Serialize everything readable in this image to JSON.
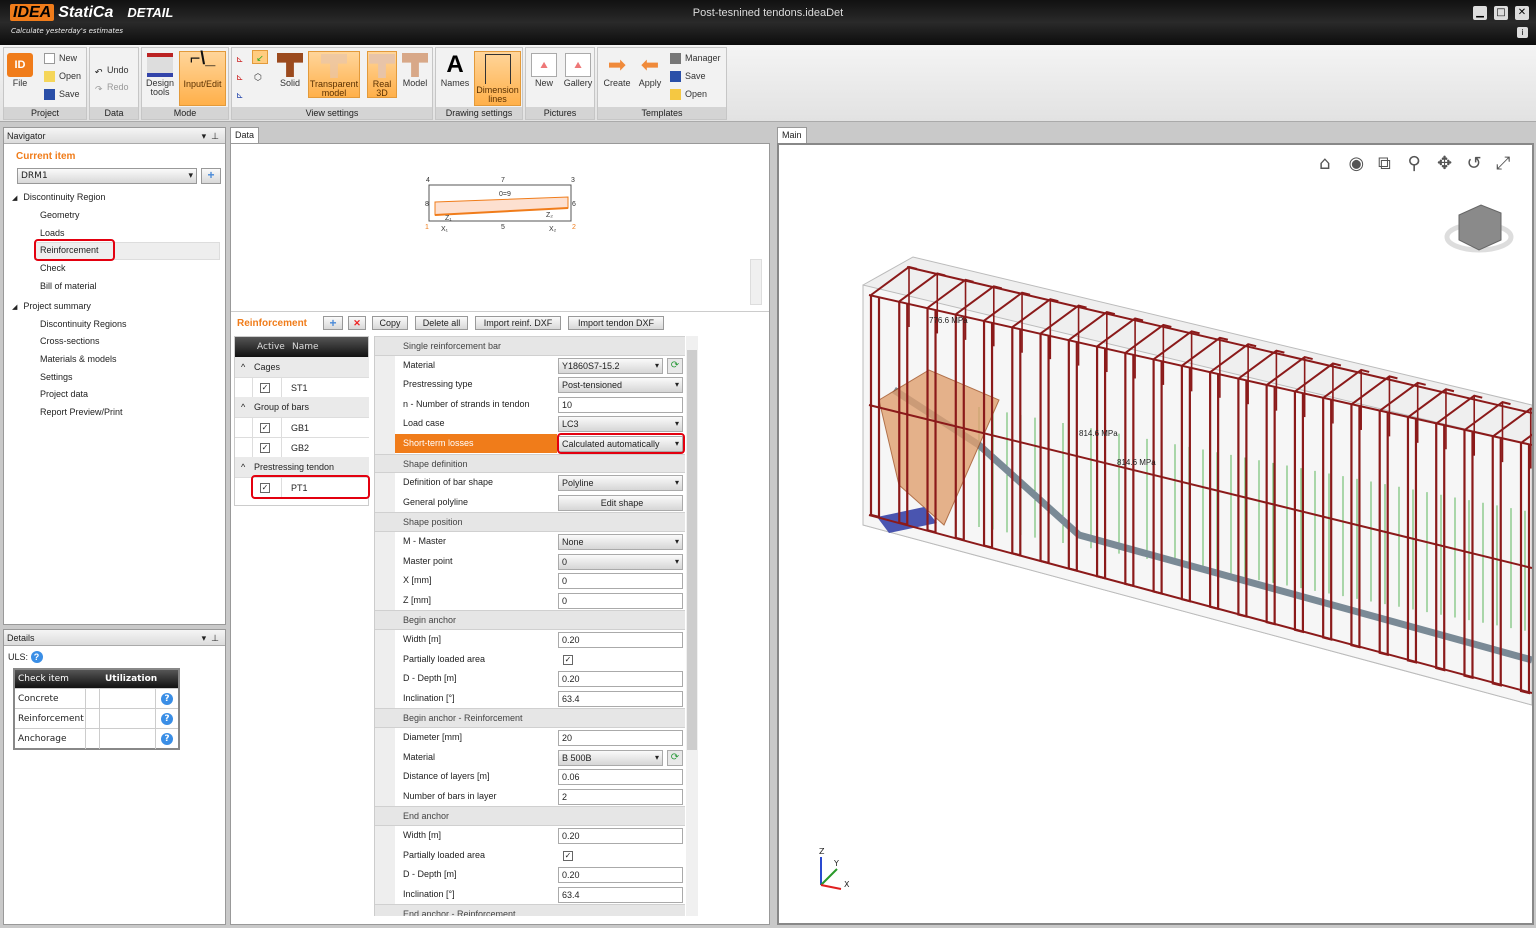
{
  "app": {
    "brand_logo": "IDEA",
    "brand": "StatiCa",
    "edition": "DETAIL",
    "tagline": "Calculate yesterday's estimates",
    "document_title": "Post-tesnined tendons.ideaDet"
  },
  "window": {
    "minimize": "▁",
    "maximize": "□",
    "close": "✕",
    "info": "i"
  },
  "ribbon": {
    "groups": {
      "project": "Project",
      "data": "Data",
      "mode": "Mode",
      "view": "View settings",
      "drawing": "Drawing settings",
      "pictures": "Pictures",
      "templates": "Templates"
    },
    "file": "File",
    "new": "New",
    "open": "Open",
    "save": "Save",
    "undo": "Undo",
    "redo": "Redo",
    "design_tools": "Design tools",
    "input_edit": "Input/Edit",
    "solid": "Solid",
    "transparent": "Transparent model",
    "real3d": "Real 3D",
    "model": "Model",
    "names": "Names",
    "dimension_lines": "Dimension lines",
    "pic_new": "New",
    "gallery": "Gallery",
    "create": "Create",
    "apply": "Apply",
    "manager": "Manager",
    "tpl_save": "Save",
    "tpl_open": "Open"
  },
  "navigator": {
    "title": "Navigator",
    "current_item_label": "Current item",
    "current_item": "DRM1",
    "sections": [
      {
        "label": "Discontinuity Region",
        "items": [
          "Geometry",
          "Loads",
          "Reinforcement",
          "Check",
          "Bill of material"
        ]
      },
      {
        "label": "Project summary",
        "items": [
          "Discontinuity Regions",
          "Cross-sections",
          "Materials & models",
          "Settings",
          "Project data",
          "Report Preview/Print"
        ]
      }
    ],
    "selected": "Reinforcement"
  },
  "details": {
    "title": "Details",
    "uls_label": "ULS:",
    "columns": [
      "Check item",
      "",
      "Utilization",
      ""
    ],
    "rows": [
      "Concrete",
      "Reinforcement",
      "Anchorage"
    ]
  },
  "data_panel": {
    "tab": "Data",
    "sketch_labels": {
      "n4": "4",
      "n7": "7",
      "n3": "3",
      "n8": "8",
      "n6": "6",
      "n09": "0=9",
      "n1": "1",
      "n5": "5",
      "n2": "2",
      "x1": "X₁",
      "x2": "X₂",
      "z1": "Z₁",
      "z2": "Z₂"
    },
    "reinforcement_title": "Reinforcement",
    "toolbar": {
      "copy": "Copy",
      "delete_all": "Delete all",
      "import_reinf": "Import reinf. DXF",
      "import_tendon": "Import tendon DXF"
    },
    "list_columns": [
      "Active",
      "Name"
    ],
    "list_groups": [
      {
        "label": "Cages",
        "items": [
          {
            "name": "ST1",
            "active": true
          }
        ]
      },
      {
        "label": "Group of bars",
        "items": [
          {
            "name": "GB1",
            "active": true
          },
          {
            "name": "GB2",
            "active": true
          }
        ]
      },
      {
        "label": "Prestressing tendon",
        "items": [
          {
            "name": "PT1",
            "active": true
          }
        ]
      }
    ],
    "properties": [
      {
        "type": "cat",
        "label": "Single reinforcement bar"
      },
      {
        "label": "Material",
        "value": "Y1860S7-15.2",
        "kind": "dd-refresh"
      },
      {
        "label": "Prestressing type",
        "value": "Post-tensioned",
        "kind": "dd"
      },
      {
        "label": "n - Number of strands in tendon",
        "value": "10",
        "kind": "text"
      },
      {
        "label": "Load case",
        "value": "LC3",
        "kind": "dd"
      },
      {
        "label": "Short-term losses",
        "value": "Calculated automatically",
        "kind": "dd",
        "selected": true
      },
      {
        "type": "cat",
        "label": "Shape definition"
      },
      {
        "label": "Definition of bar shape",
        "value": "Polyline",
        "kind": "dd"
      },
      {
        "label": "General polyline",
        "value": "Edit shape",
        "kind": "button"
      },
      {
        "type": "cat",
        "label": "Shape position"
      },
      {
        "label": "M - Master",
        "value": "None",
        "kind": "dd"
      },
      {
        "label": "Master point",
        "value": "0",
        "kind": "dd"
      },
      {
        "label": "X [mm]",
        "value": "0",
        "kind": "text"
      },
      {
        "label": "Z [mm]",
        "value": "0",
        "kind": "text"
      },
      {
        "type": "cat",
        "label": "Begin anchor"
      },
      {
        "label": "Width [m]",
        "value": "0.20",
        "kind": "text"
      },
      {
        "label": "Partially loaded area",
        "value": true,
        "kind": "check"
      },
      {
        "label": "D - Depth [m]",
        "value": "0.20",
        "kind": "text"
      },
      {
        "label": "Inclination [°]",
        "value": "63.4",
        "kind": "text"
      },
      {
        "type": "cat",
        "label": "Begin anchor - Reinforcement"
      },
      {
        "label": "Diameter [mm]",
        "value": "20",
        "kind": "text"
      },
      {
        "label": "Material",
        "value": "B 500B",
        "kind": "dd-refresh"
      },
      {
        "label": "Distance of layers [m]",
        "value": "0.06",
        "kind": "text"
      },
      {
        "label": "Number of bars in layer",
        "value": "2",
        "kind": "text"
      },
      {
        "type": "cat",
        "label": "End anchor"
      },
      {
        "label": "Width [m]",
        "value": "0.20",
        "kind": "text"
      },
      {
        "label": "Partially loaded area",
        "value": true,
        "kind": "check"
      },
      {
        "label": "D - Depth [m]",
        "value": "0.20",
        "kind": "text"
      },
      {
        "label": "Inclination [°]",
        "value": "63.4",
        "kind": "text"
      },
      {
        "type": "cat",
        "label": "End anchor - Reinforcement"
      }
    ]
  },
  "main_panel": {
    "tab": "Main",
    "view_tools": [
      "home-icon",
      "eye-icon",
      "zoom-window-icon",
      "zoom-icon",
      "pan-icon",
      "rotate-icon",
      "fullscreen-icon"
    ],
    "stress_labels": [
      "776.6 MPa",
      "814.6 MPa",
      "814.6 MPa"
    ],
    "axes": {
      "x": "X",
      "y": "Y",
      "z": "Z"
    }
  },
  "colors": {
    "accent": "#f07c1a",
    "highlight": "#e3000f",
    "stirrup": "#8b1a1a",
    "tendon": "#7a8a96",
    "link": "#1a9a1a"
  }
}
